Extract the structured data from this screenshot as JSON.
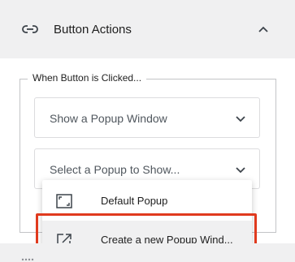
{
  "panel": {
    "title": "Button Actions",
    "icon": "link-icon",
    "collapse_icon": "chevron-up-icon"
  },
  "section": {
    "legend": "When Button is Clicked..."
  },
  "action_select": {
    "value": "Show a Popup Window",
    "icon": "chevron-down-icon"
  },
  "popup_select": {
    "placeholder": "Select a Popup to Show...",
    "icon": "chevron-down-icon"
  },
  "dropdown": {
    "items": [
      {
        "label": "Default Popup",
        "icon": "popup-frame-icon"
      },
      {
        "label": "Create a new Popup Wind...",
        "icon": "open-external-icon"
      }
    ]
  },
  "colors": {
    "highlight": "#e03a1e",
    "header_bg": "#f0f0f1"
  }
}
